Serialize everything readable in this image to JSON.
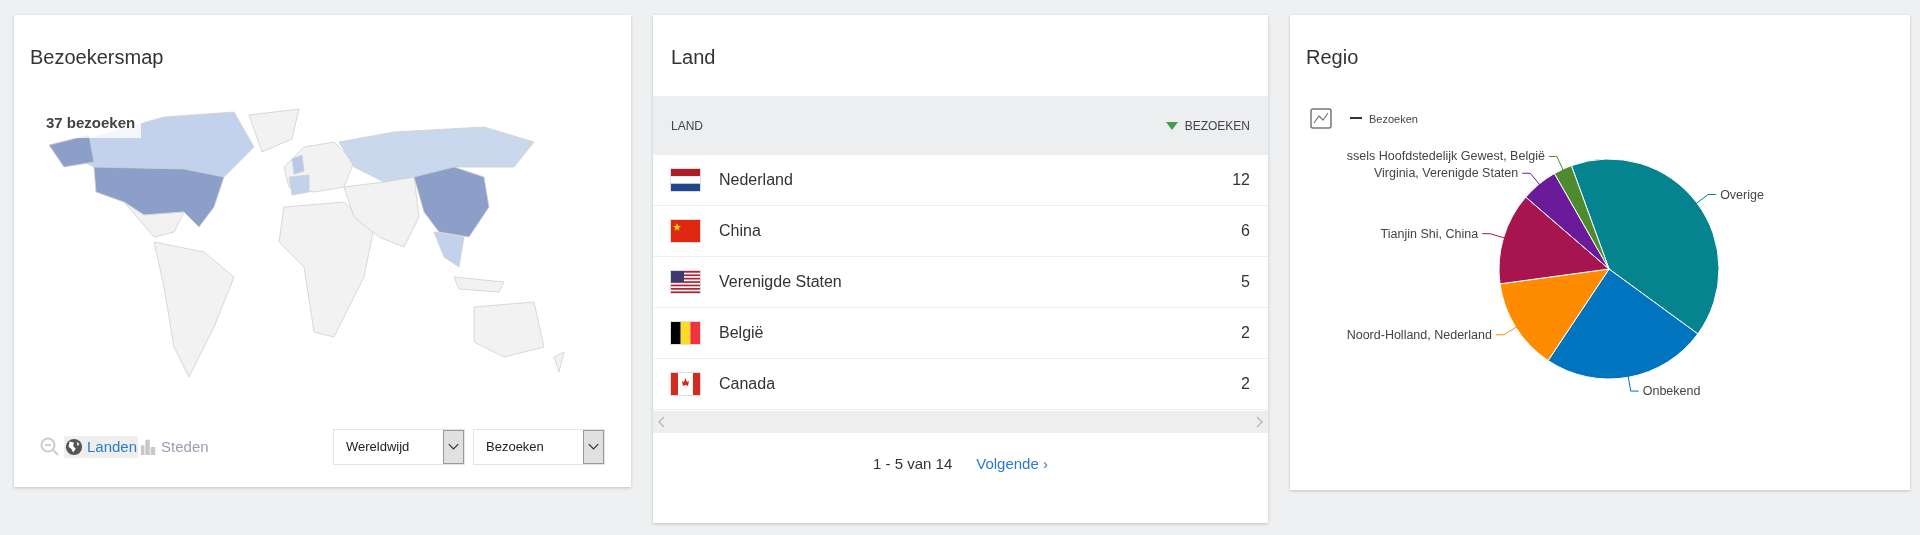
{
  "map_card": {
    "title": "Bezoekersmap",
    "tooltip": "37 bezoeken",
    "view_tabs": [
      {
        "label": "Landen",
        "selected": true,
        "kind": "globe"
      },
      {
        "label": "Steden",
        "selected": false,
        "kind": "city"
      }
    ],
    "dropdowns": [
      {
        "value": "Wereldwijd"
      },
      {
        "value": "Bezoeken"
      }
    ]
  },
  "country_card": {
    "title": "Land",
    "columns": [
      {
        "label": "LAND",
        "sorted": false
      },
      {
        "label": "BEZOEKEN",
        "sorted": true
      }
    ],
    "rows": [
      {
        "kind": "nl",
        "country": "Nederland",
        "visits": "12"
      },
      {
        "kind": "cn",
        "country": "China",
        "visits": "6"
      },
      {
        "kind": "us",
        "country": "Verenigde Staten",
        "visits": "5"
      },
      {
        "kind": "be",
        "country": "België",
        "visits": "2"
      },
      {
        "kind": "ca",
        "country": "Canada",
        "visits": "2"
      }
    ],
    "pagination": {
      "range": "1 - 5 van 14",
      "next": "Volgende ›"
    }
  },
  "region_card": {
    "title": "Regio",
    "chart_data": {
      "type": "pie",
      "categories": [
        "Overige",
        "Onbekend",
        "Noord-Holland, Nederland",
        "Tianjin Shi, China",
        "Virginia, Verenigde Staten",
        "ssels Hoofdstedelijk Gewest, België"
      ],
      "series": [
        {
          "name": "Bezoeken",
          "values": [
            40.6,
            24.3,
            13.5,
            13.5,
            5.4,
            2.7
          ]
        }
      ],
      "colors": [
        "#05838e",
        "#0074bf",
        "#ff8c00",
        "#a8144f",
        "#6a1b9a",
        "#4e8b2e"
      ]
    }
  }
}
